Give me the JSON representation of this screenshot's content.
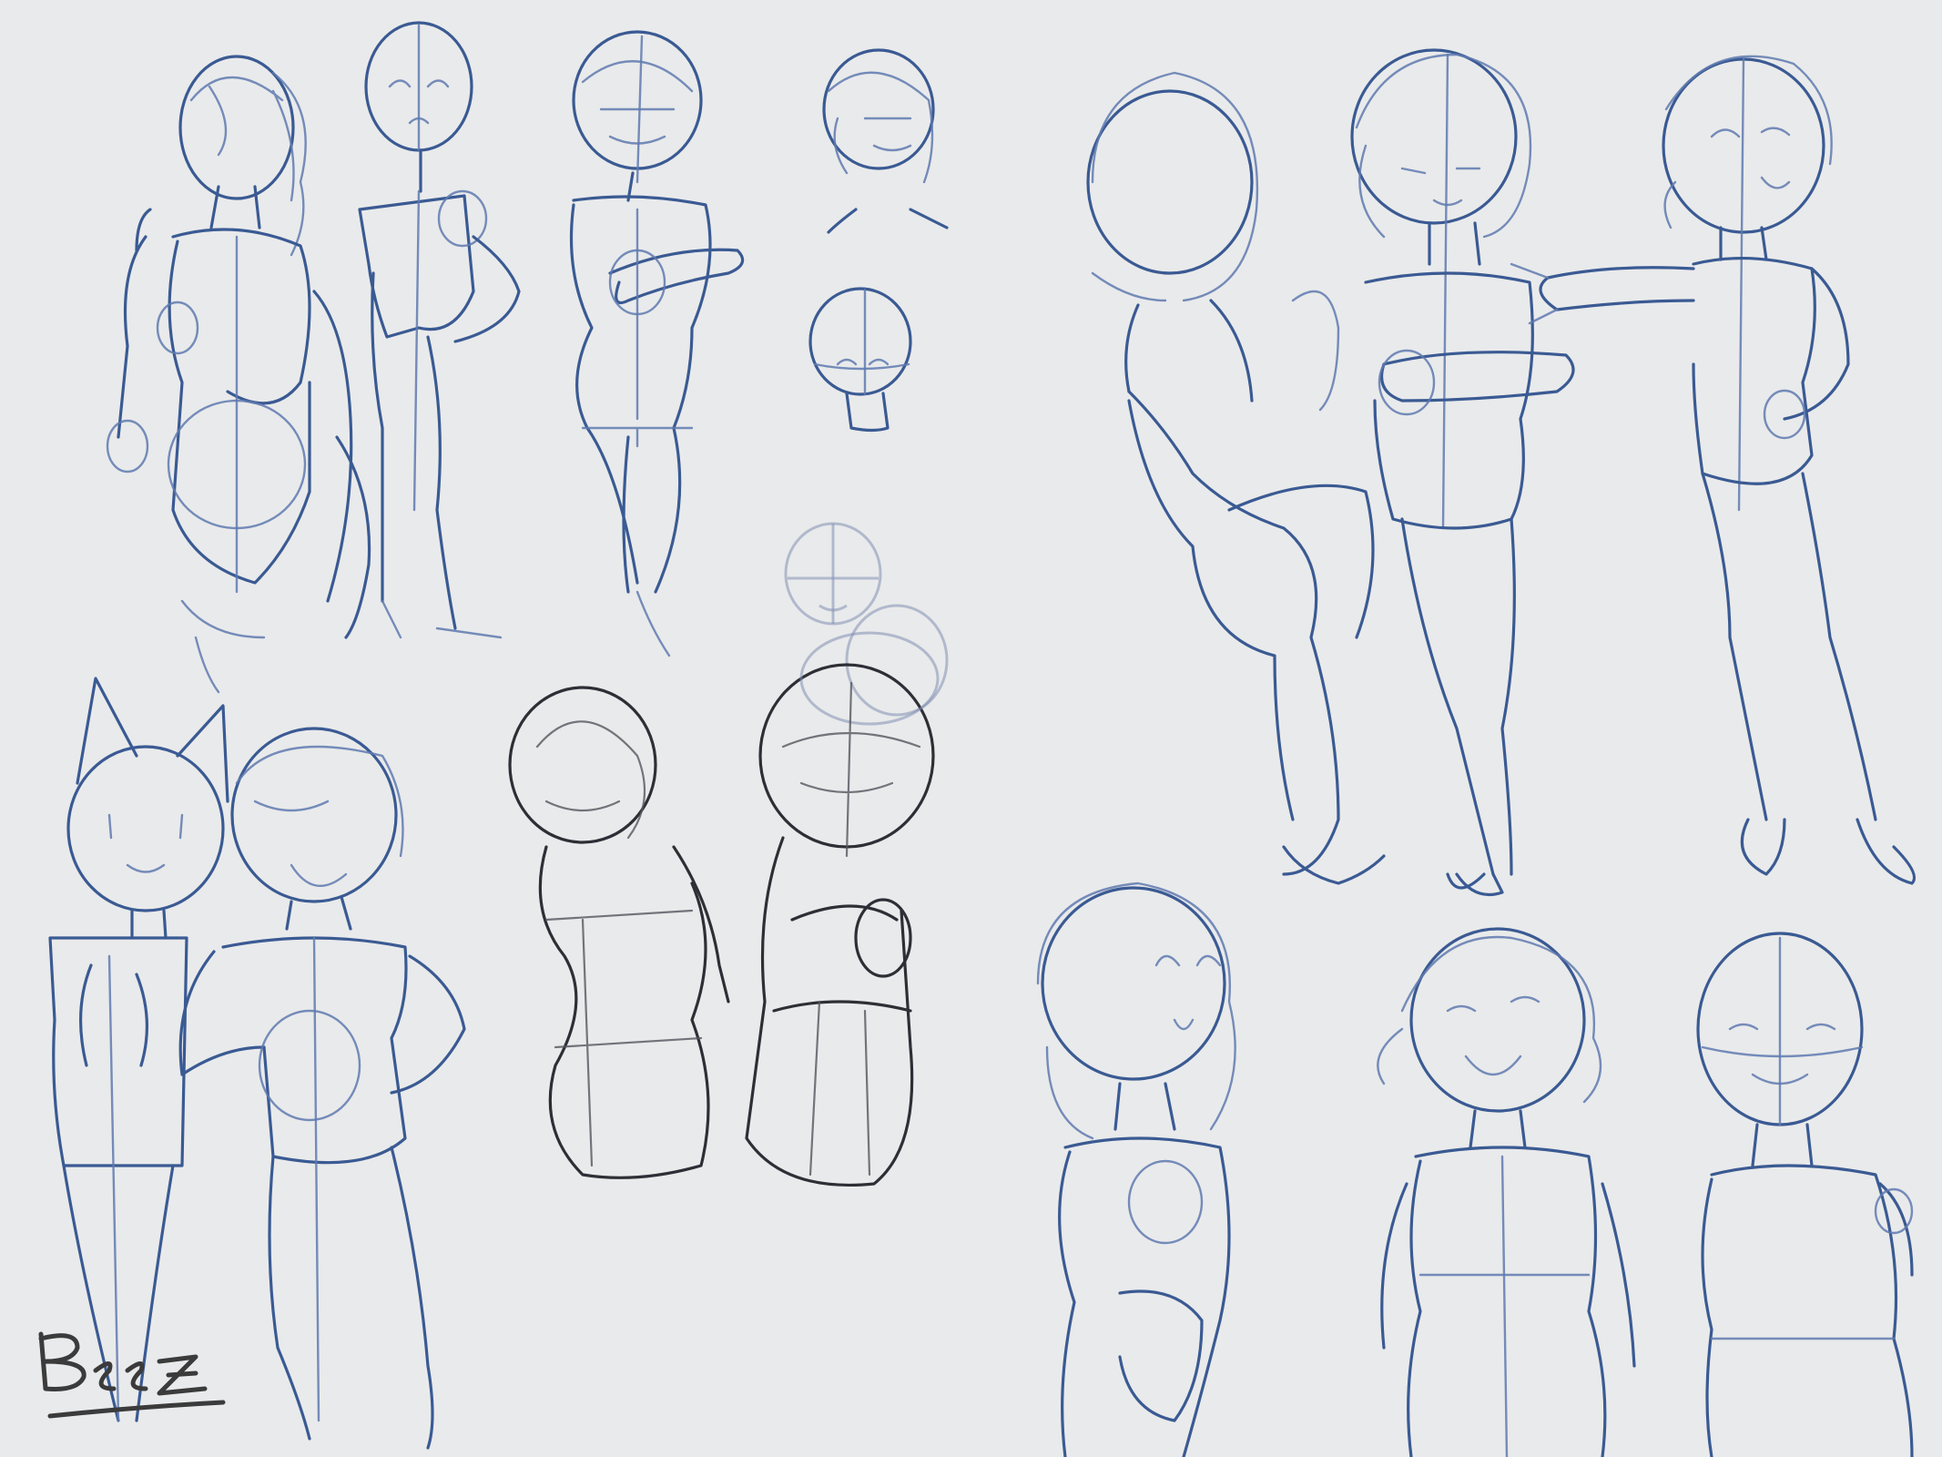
{
  "image": {
    "background_color": "#e9eaeb",
    "sketch_colors": {
      "blue_pencil": "#3a5a93",
      "dark_pencil": "#2e2e36"
    },
    "signature": {
      "text": "Beez",
      "rendered_as_picture": true
    }
  }
}
